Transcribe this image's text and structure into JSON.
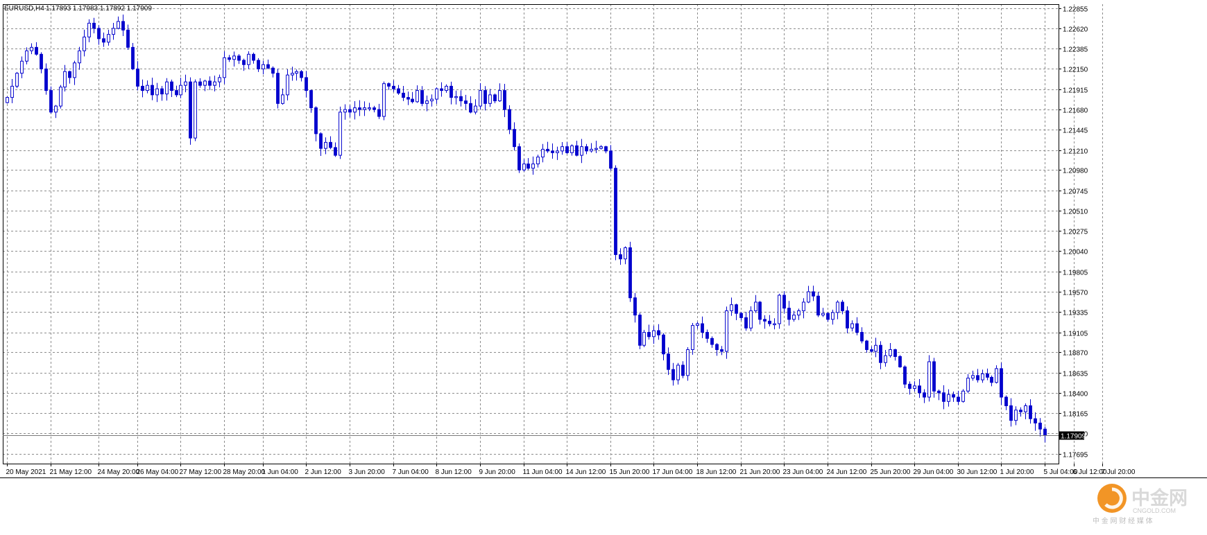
{
  "header": {
    "symbol_timeframe": "EURUSD,H4",
    "ohlc": "1.17893 1.17983 1.17892 1.17909"
  },
  "watermark": {
    "brand": "中金网",
    "domain": "CNGOLD.COM",
    "caption": "中 金 网 财 经 媒 体"
  },
  "colors": {
    "bear": "#0000cd",
    "bull_outline": "#0000cd",
    "bull_fill": "#ffffff",
    "grid": "#8b8b8b",
    "axis": "#000000",
    "current_price_label_bg": "#000000",
    "watermark_orange": "#f08300"
  },
  "chart_data": {
    "type": "candlestick",
    "symbol": "EURUSD",
    "timeframe": "H4",
    "current_price": 1.17909,
    "ylim": [
      1.1758,
      1.229
    ],
    "yticks": [
      1.22855,
      1.2262,
      1.22385,
      1.2215,
      1.21915,
      1.2168,
      1.21445,
      1.2121,
      1.2098,
      1.20745,
      1.2051,
      1.20275,
      1.2004,
      1.198,
      1.1957,
      1.19335,
      1.191,
      1.1887,
      1.18635,
      1.184,
      1.18165,
      1.1793,
      1.17695
    ],
    "ytick_labels": [
      "1.22855",
      "1.22620",
      "1.22385",
      "1.22150",
      "1.21915",
      "1.21680",
      "1.21445",
      "1.21210",
      "1.20980",
      "1.20745",
      "1.20510",
      "1.20275",
      "1.20040",
      "1.19805",
      "1.19570",
      "1.19335",
      "1.19105",
      "1.18870",
      "1.18635",
      "1.18400",
      "1.18165",
      "1.17930",
      "1.17695"
    ],
    "current_price_label": "1.17909",
    "xtick_labels": [
      {
        "index": 0,
        "label": "20 May 2021"
      },
      {
        "index": 9,
        "label": "21 May 12:00"
      },
      {
        "index": 19,
        "label": "24 May 20:00"
      },
      {
        "index": 27,
        "label": "26 May 04:00"
      },
      {
        "index": 36,
        "label": "27 May 12:00"
      },
      {
        "index": 45,
        "label": "28 May 20:00"
      },
      {
        "index": 53,
        "label": "1 Jun 04:00"
      },
      {
        "index": 62,
        "label": "2 Jun 12:00"
      },
      {
        "index": 71,
        "label": "3 Jun 20:00"
      },
      {
        "index": 80,
        "label": "7 Jun 04:00"
      },
      {
        "index": 89,
        "label": "8 Jun 12:00"
      },
      {
        "index": 98,
        "label": "9 Jun 20:00"
      },
      {
        "index": 107,
        "label": "11 Jun 04:00"
      },
      {
        "index": 116,
        "label": "14 Jun 12:00"
      },
      {
        "index": 125,
        "label": "15 Jun 20:00"
      },
      {
        "index": 134,
        "label": "17 Jun 04:00"
      },
      {
        "index": 143,
        "label": "18 Jun 12:00"
      },
      {
        "index": 152,
        "label": "21 Jun 20:00"
      },
      {
        "index": 161,
        "label": "23 Jun 04:00"
      },
      {
        "index": 170,
        "label": "24 Jun 12:00"
      },
      {
        "index": 179,
        "label": "25 Jun 20:00"
      },
      {
        "index": 188,
        "label": "29 Jun 04:00"
      },
      {
        "index": 197,
        "label": "30 Jun 12:00"
      },
      {
        "index": 206,
        "label": "1 Jul 20:00"
      },
      {
        "index": 215,
        "label": "5 Jul 04:00"
      },
      {
        "index": 221,
        "label": "6 Jul 12:00"
      },
      {
        "index": 227,
        "label": "7 Jul 20:00"
      }
    ],
    "closes": [
      1.2182,
      1.2195,
      1.221,
      1.2224,
      1.2236,
      1.224,
      1.2232,
      1.2215,
      1.219,
      1.2165,
      1.2172,
      1.2194,
      1.2212,
      1.2205,
      1.2222,
      1.2236,
      1.2252,
      1.2268,
      1.2262,
      1.225,
      1.2246,
      1.2255,
      1.2262,
      1.227,
      1.226,
      1.224,
      1.2215,
      1.2195,
      1.219,
      1.2196,
      1.2185,
      1.2192,
      1.2186,
      1.22,
      1.219,
      1.2185,
      1.2196,
      1.22,
      1.2135,
      1.22,
      1.2196,
      1.2201,
      1.2196,
      1.22,
      1.2205,
      1.2228,
      1.2226,
      1.223,
      1.2225,
      1.222,
      1.2232,
      1.2225,
      1.2215,
      1.222,
      1.2216,
      1.221,
      1.2175,
      1.2185,
      1.2208,
      1.221,
      1.2212,
      1.2205,
      1.219,
      1.217,
      1.214,
      1.2123,
      1.213,
      1.2124,
      1.2115,
      1.2165,
      1.2168,
      1.2165,
      1.217,
      1.2168,
      1.217,
      1.217,
      1.2168,
      1.216,
      1.2198,
      1.2195,
      1.2192,
      1.2187,
      1.2182,
      1.218,
      1.2177,
      1.219,
      1.2175,
      1.2178,
      1.218,
      1.2192,
      1.219,
      1.2195,
      1.2182,
      1.2183,
      1.2178,
      1.2175,
      1.2165,
      1.2172,
      1.219,
      1.2175,
      1.2185,
      1.2178,
      1.219,
      1.2168,
      1.2145,
      1.2125,
      1.2098,
      1.2105,
      1.21,
      1.2105,
      1.2113,
      1.2122,
      1.212,
      1.2118,
      1.212,
      1.2125,
      1.2118,
      1.2126,
      1.2115,
      1.2125,
      1.212,
      1.2122,
      1.2123,
      1.2125,
      1.212,
      1.21,
      1.2,
      1.1995,
      1.2008,
      1.195,
      1.193,
      1.1895,
      1.191,
      1.1905,
      1.1912,
      1.1907,
      1.1885,
      1.1867,
      1.1855,
      1.1872,
      1.186,
      1.189,
      1.1918,
      1.192,
      1.191,
      1.1903,
      1.1896,
      1.189,
      1.1888,
      1.1935,
      1.1942,
      1.1932,
      1.1927,
      1.1915,
      1.1935,
      1.1945,
      1.1925,
      1.1923,
      1.192,
      1.192,
      1.1953,
      1.1938,
      1.1925,
      1.193,
      1.1935,
      1.1945,
      1.1957,
      1.1952,
      1.193,
      1.1932,
      1.1925,
      1.1933,
      1.1945,
      1.1935,
      1.1915,
      1.192,
      1.191,
      1.19,
      1.189,
      1.1888,
      1.1895,
      1.1875,
      1.1883,
      1.189,
      1.1882,
      1.187,
      1.185,
      1.1845,
      1.1848,
      1.184,
      1.1835,
      1.1876,
      1.1842,
      1.184,
      1.183,
      1.1838,
      1.1835,
      1.183,
      1.1842,
      1.1857,
      1.186,
      1.1855,
      1.1862,
      1.1858,
      1.1852,
      1.1868,
      1.1835,
      1.1825,
      1.1808,
      1.182,
      1.1818,
      1.1825,
      1.181,
      1.1805,
      1.1798,
      1.1791
    ]
  }
}
